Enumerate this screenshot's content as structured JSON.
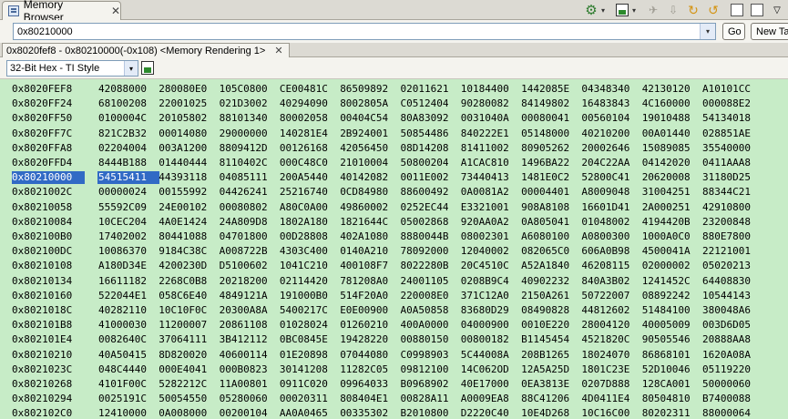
{
  "view": {
    "title": "Memory Browser",
    "close": "✕"
  },
  "icons": {
    "gear": "⚙",
    "dropdown": "▾",
    "export": "export-icon",
    "gray1": "✈",
    "gray2": "⇩",
    "refresh1": "↻",
    "refresh2": "↺",
    "new_view": "new-view-icon",
    "menu": "▽"
  },
  "address": {
    "value": "0x80210000",
    "go_label": "Go",
    "new_tab_label": "New Tab"
  },
  "rendering_tab": {
    "label": "0x8020fef8 - 0x80210000(-0x108) <Memory Rendering 1>",
    "close": "✕"
  },
  "format": {
    "selected": "32-Bit Hex - TI Style"
  },
  "colors": {
    "grid_bg": "#c7ecc7",
    "selection": "#316ac5"
  },
  "grid": {
    "selected_row": 6,
    "selected_col": 0,
    "rows": [
      {
        "addr": "0x8020FEF8",
        "cells": [
          "42088000",
          "280080E0",
          "105C0800",
          "CE00481C",
          "86509892",
          "02011621",
          "10184400",
          "1442085E",
          "04348340",
          "42130120",
          "A10101CC"
        ]
      },
      {
        "addr": "0x8020FF24",
        "cells": [
          "68100208",
          "22001025",
          "021D3002",
          "40294090",
          "8002805A",
          "C0512404",
          "90280082",
          "84149802",
          "16483843",
          "4C160000",
          "000088E2"
        ]
      },
      {
        "addr": "0x8020FF50",
        "cells": [
          "0100004C",
          "20105802",
          "88101340",
          "80002058",
          "00404C54",
          "80A83092",
          "0031040A",
          "00080041",
          "00560104",
          "19010488",
          "54134018"
        ]
      },
      {
        "addr": "0x8020FF7C",
        "cells": [
          "821C2B32",
          "00014080",
          "29000000",
          "140281E4",
          "2B924001",
          "50854486",
          "840222E1",
          "05148000",
          "40210200",
          "00A01440",
          "028851AE"
        ]
      },
      {
        "addr": "0x8020FFA8",
        "cells": [
          "02204004",
          "003A1200",
          "8809412D",
          "00126168",
          "42056450",
          "08D14208",
          "81411002",
          "80905262",
          "20002646",
          "15089085",
          "35540000"
        ]
      },
      {
        "addr": "0x8020FFD4",
        "cells": [
          "8444B188",
          "01440444",
          "8110402C",
          "000C48C0",
          "21010004",
          "50800204",
          "A1CAC810",
          "1496BA22",
          "204C22AA",
          "04142020",
          "0411AAA8"
        ]
      },
      {
        "addr": "0x80210000",
        "cells": [
          "54515411",
          "44393118",
          "04085111",
          "200A5440",
          "40142082",
          "0011E002",
          "73440413",
          "1481E0C2",
          "52800C41",
          "20620008",
          "31180D25"
        ]
      },
      {
        "addr": "0x8021002C",
        "cells": [
          "00000024",
          "00155992",
          "04426241",
          "25216740",
          "0CD84980",
          "88600492",
          "0A0081A2",
          "00004401",
          "A8009048",
          "31004251",
          "88344C21"
        ]
      },
      {
        "addr": "0x80210058",
        "cells": [
          "55592C09",
          "24E00102",
          "00080802",
          "A80C0A00",
          "49860002",
          "0252EC44",
          "E3321001",
          "908A8108",
          "16601D41",
          "2A000251",
          "42910800"
        ]
      },
      {
        "addr": "0x80210084",
        "cells": [
          "10CEC204",
          "4A0E1424",
          "24A809D8",
          "1802A180",
          "1821644C",
          "05002868",
          "920AA0A2",
          "0A805041",
          "01048002",
          "4194420B",
          "23200848"
        ]
      },
      {
        "addr": "0x802100B0",
        "cells": [
          "17402002",
          "80441088",
          "04701800",
          "00D28808",
          "402A1080",
          "8880044B",
          "08002301",
          "A6080100",
          "A0800300",
          "1000A0C0",
          "880E7800"
        ]
      },
      {
        "addr": "0x802100DC",
        "cells": [
          "10086370",
          "9184C38C",
          "A008722B",
          "4303C400",
          "0140A210",
          "78092000",
          "12040002",
          "082065C0",
          "606A0B98",
          "4500041A",
          "22121001"
        ]
      },
      {
        "addr": "0x80210108",
        "cells": [
          "A180D34E",
          "4200230D",
          "D5100602",
          "1041C210",
          "400108F7",
          "8022280B",
          "20C4510C",
          "A52A1840",
          "46208115",
          "02000002",
          "05020213"
        ]
      },
      {
        "addr": "0x80210134",
        "cells": [
          "16611182",
          "2268C0B8",
          "20218200",
          "02114420",
          "781208A0",
          "24001105",
          "0208B9C4",
          "40902232",
          "840A3B02",
          "1241452C",
          "64408830"
        ]
      },
      {
        "addr": "0x80210160",
        "cells": [
          "522044E1",
          "058C6E40",
          "4849121A",
          "191000B0",
          "514F20A0",
          "220008E0",
          "371C12A0",
          "2150A261",
          "50722007",
          "08892242",
          "10544143"
        ]
      },
      {
        "addr": "0x8021018C",
        "cells": [
          "40282110",
          "10C10F0C",
          "20300A8A",
          "5400217C",
          "E0E00900",
          "A0A50858",
          "83680D29",
          "08490828",
          "44812602",
          "51484100",
          "380048A6"
        ]
      },
      {
        "addr": "0x802101B8",
        "cells": [
          "41000030",
          "11200007",
          "20861108",
          "01028024",
          "01260210",
          "400A0000",
          "04000900",
          "0010E220",
          "28004120",
          "40005009",
          "003D6D05"
        ]
      },
      {
        "addr": "0x802101E4",
        "cells": [
          "0082640C",
          "37064111",
          "3B412112",
          "0BC0845E",
          "19428220",
          "00880150",
          "00800182",
          "B1145454",
          "4521820C",
          "90505546",
          "20888AA8"
        ]
      },
      {
        "addr": "0x80210210",
        "cells": [
          "40A50415",
          "8D820020",
          "40600114",
          "01E20898",
          "07044080",
          "C0998903",
          "5C44008A",
          "208B1265",
          "18024070",
          "86868101",
          "1620A08A"
        ]
      },
      {
        "addr": "0x8021023C",
        "cells": [
          "048C4440",
          "000E4041",
          "000B0823",
          "30141208",
          "11282C05",
          "09812100",
          "14C062OD",
          "12A5A25D",
          "1801C23E",
          "52D10046",
          "05119220"
        ]
      },
      {
        "addr": "0x80210268",
        "cells": [
          "4101F00C",
          "5282212C",
          "11A00801",
          "0911C020",
          "09964033",
          "B0968902",
          "40E17000",
          "0EA3813E",
          "0207D888",
          "128CA001",
          "50000060"
        ]
      },
      {
        "addr": "0x80210294",
        "cells": [
          "0025191C",
          "50054550",
          "05280060",
          "00020311",
          "808404E1",
          "00828A11",
          "A0009EA8",
          "88C41206",
          "4D0411E4",
          "80504810",
          "B7400088"
        ]
      },
      {
        "addr": "0x802102C0",
        "cells": [
          "12410000",
          "0A008000",
          "00200104",
          "AA0A0465",
          "00335302",
          "B2010800",
          "D2220C40",
          "10E4D268",
          "10C16C00",
          "80202311",
          "88000064"
        ]
      }
    ]
  }
}
